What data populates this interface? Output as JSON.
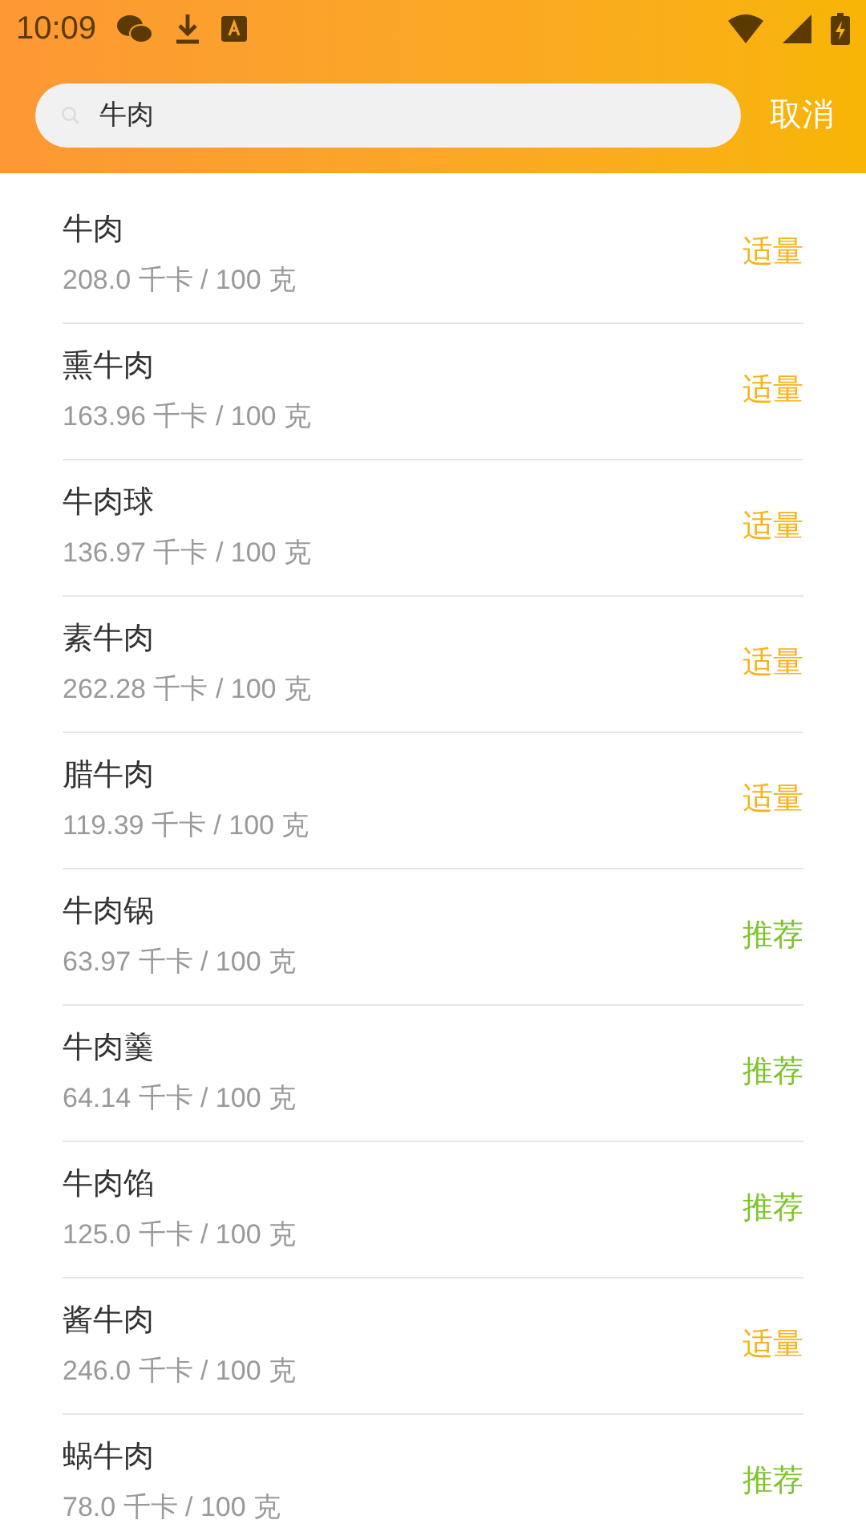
{
  "status_bar": {
    "time": "10:09"
  },
  "search": {
    "value": "牛肉",
    "cancel": "取消"
  },
  "results": [
    {
      "name": "牛肉",
      "energy": "208.0 千卡 / 100 克",
      "rating": "适量",
      "color": "#f7b21c"
    },
    {
      "name": "熏牛肉",
      "energy": "163.96 千卡 / 100 克",
      "rating": "适量",
      "color": "#f7b21c"
    },
    {
      "name": "牛肉球",
      "energy": "136.97 千卡 / 100 克",
      "rating": "适量",
      "color": "#f7b21c"
    },
    {
      "name": "素牛肉",
      "energy": "262.28 千卡 / 100 克",
      "rating": "适量",
      "color": "#f7b21c"
    },
    {
      "name": "腊牛肉",
      "energy": "119.39 千卡 / 100 克",
      "rating": "适量",
      "color": "#f7b21c"
    },
    {
      "name": "牛肉锅",
      "energy": "63.97 千卡 / 100 克",
      "rating": "推荐",
      "color": "#7cc42a"
    },
    {
      "name": "牛肉羹",
      "energy": "64.14 千卡 / 100 克",
      "rating": "推荐",
      "color": "#7cc42a"
    },
    {
      "name": "牛肉馅",
      "energy": "125.0 千卡 / 100 克",
      "rating": "推荐",
      "color": "#7cc42a"
    },
    {
      "name": "酱牛肉",
      "energy": "246.0 千卡 / 100 克",
      "rating": "适量",
      "color": "#f7b21c"
    },
    {
      "name": "蜗牛肉",
      "energy": "78.0 千卡 / 100 克",
      "rating": "推荐",
      "color": "#7cc42a"
    }
  ]
}
